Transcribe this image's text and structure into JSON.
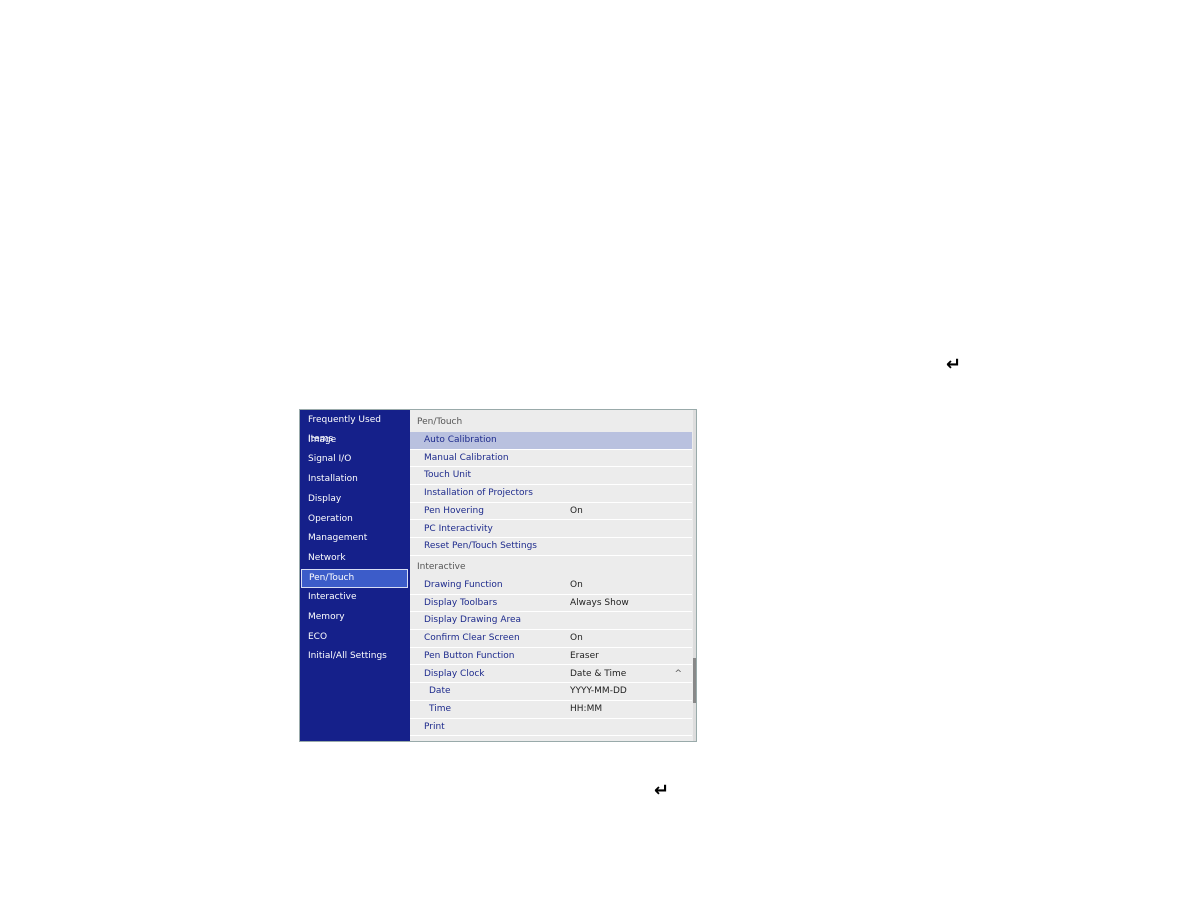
{
  "sidebar": {
    "items": [
      "Frequently Used Items",
      "Image",
      "Signal I/O",
      "Installation",
      "Display",
      "Operation",
      "Management",
      "Network",
      "Pen/Touch",
      "Interactive",
      "Memory",
      "ECO",
      "Initial/All Settings"
    ],
    "selected": "Pen/Touch"
  },
  "sections": [
    {
      "title": "Pen/Touch",
      "rows": [
        {
          "label": "Auto Calibration",
          "value": ""
        },
        {
          "label": "Manual Calibration",
          "value": ""
        },
        {
          "label": "Touch Unit",
          "value": ""
        },
        {
          "label": "Installation of Projectors",
          "value": ""
        },
        {
          "label": "Pen Hovering",
          "value": "On"
        },
        {
          "label": "PC Interactivity",
          "value": ""
        },
        {
          "label": "Reset Pen/Touch Settings",
          "value": ""
        }
      ]
    },
    {
      "title": "Interactive",
      "rows": [
        {
          "label": "Drawing Function",
          "value": "On"
        },
        {
          "label": "Display Toolbars",
          "value": "Always Show"
        },
        {
          "label": "Display Drawing Area",
          "value": ""
        },
        {
          "label": "Confirm Clear Screen",
          "value": "On"
        },
        {
          "label": "Pen Button Function",
          "value": "Eraser"
        },
        {
          "label": "Display Clock",
          "value": "Date & Time",
          "expanded": true
        },
        {
          "label": "Date",
          "value": "YYYY-MM-DD",
          "sub": true
        },
        {
          "label": "Time",
          "value": "HH:MM",
          "sub": true
        },
        {
          "label": "Print",
          "value": ""
        }
      ]
    }
  ],
  "icons": {
    "enter": "↵",
    "collapse": "^"
  },
  "colors": {
    "sidebar": "#15208a",
    "selected": "#3c5cc9",
    "highlight": "#b9c1df"
  }
}
